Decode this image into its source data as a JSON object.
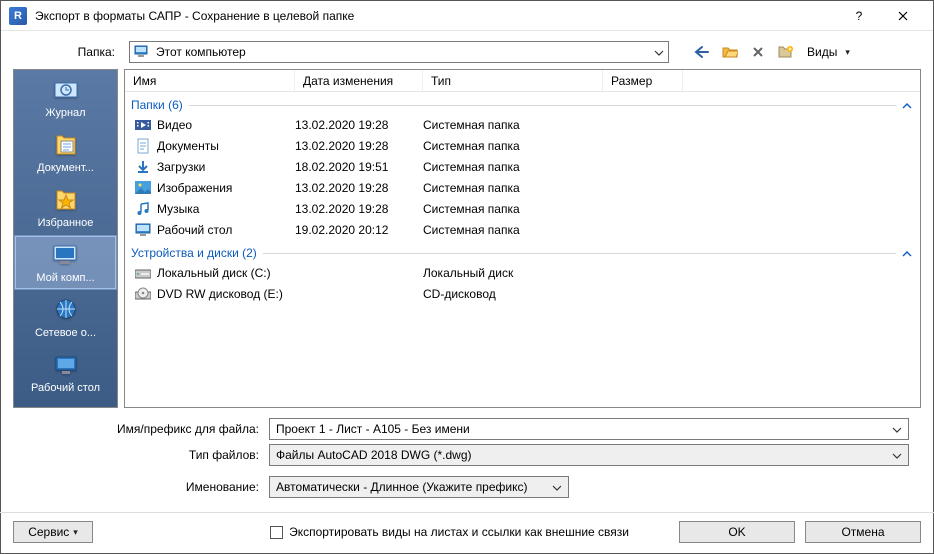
{
  "window": {
    "title": "Экспорт в форматы САПР - Сохранение в целевой папке"
  },
  "toolbar": {
    "folder_label": "Папка:",
    "folder_value": "Этот компьютер",
    "views_label": "Виды"
  },
  "places": [
    {
      "label": "Журнал",
      "icon": "history"
    },
    {
      "label": "Документ...",
      "icon": "doc"
    },
    {
      "label": "Избранное",
      "icon": "fav"
    },
    {
      "label": "Мой комп...",
      "icon": "pc",
      "selected": true
    },
    {
      "label": "Сетевое о...",
      "icon": "net"
    },
    {
      "label": "Рабочий стол",
      "icon": "desk"
    }
  ],
  "columns": {
    "name": "Имя",
    "date": "Дата изменения",
    "type": "Тип",
    "size": "Размер"
  },
  "groups": [
    {
      "label": "Папки (6)",
      "items": [
        {
          "icon": "video",
          "name": "Видео",
          "date": "13.02.2020 19:28",
          "type": "Системная папка"
        },
        {
          "icon": "doc",
          "name": "Документы",
          "date": "13.02.2020 19:28",
          "type": "Системная папка"
        },
        {
          "icon": "download",
          "name": "Загрузки",
          "date": "18.02.2020 19:51",
          "type": "Системная папка"
        },
        {
          "icon": "image",
          "name": "Изображения",
          "date": "13.02.2020 19:28",
          "type": "Системная папка"
        },
        {
          "icon": "music",
          "name": "Музыка",
          "date": "13.02.2020 19:28",
          "type": "Системная папка"
        },
        {
          "icon": "desktop",
          "name": "Рабочий стол",
          "date": "19.02.2020 20:12",
          "type": "Системная папка"
        }
      ]
    },
    {
      "label": "Устройства и диски (2)",
      "items": [
        {
          "icon": "hdd",
          "name": "Локальный диск (C:)",
          "date": "",
          "type": "Локальный диск"
        },
        {
          "icon": "dvd",
          "name": "DVD RW дисковод (E:)",
          "date": "",
          "type": "CD-дисковод"
        }
      ]
    }
  ],
  "fields": {
    "filename_label": "Имя/префикс для файла:",
    "filename_value": "Проект 1 - Лист - А105 - Без имени",
    "filetype_label": "Тип файлов:",
    "filetype_value": "Файлы AutoCAD 2018 DWG  (*.dwg)",
    "naming_label": "Именование:",
    "naming_value": "Автоматически - Длинное (Укажите префикс)"
  },
  "footer": {
    "service_label": "Сервис",
    "export_checkbox_label": "Экспортировать виды на листах и ссылки как внешние связи",
    "ok": "OK",
    "cancel": "Отмена"
  }
}
